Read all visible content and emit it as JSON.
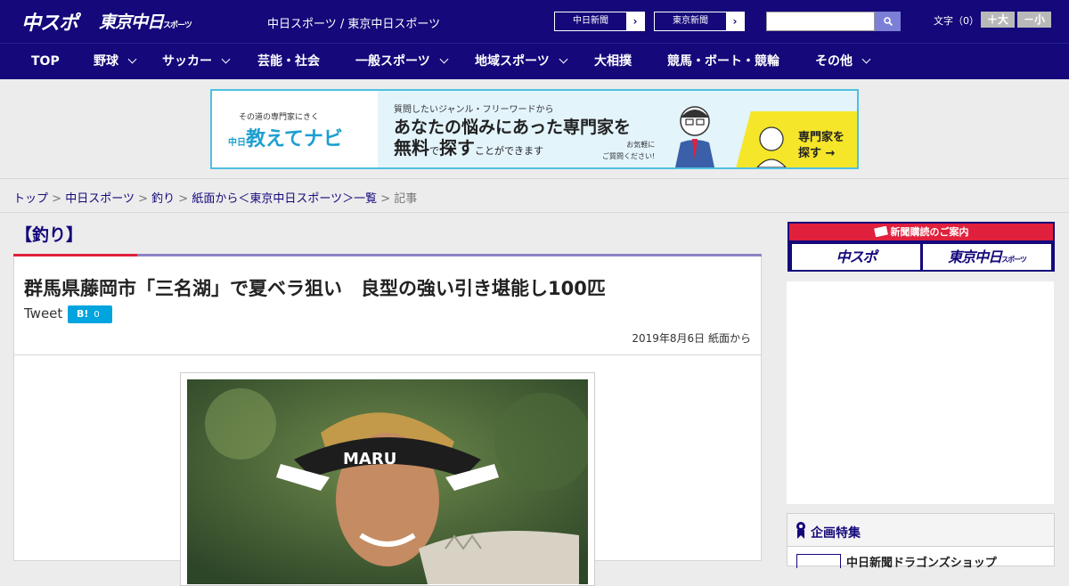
{
  "header": {
    "logo_chuspo": "中スポ",
    "logo_tokyo": "東京中日",
    "logo_tokyo_sub": "スポーツ",
    "site_name": "中日スポーツ / 東京中日スポーツ",
    "paper_links": [
      {
        "label": "中日新聞",
        "arrow": "›"
      },
      {
        "label": "東京新聞",
        "arrow": "›"
      }
    ],
    "search": {
      "placeholder": "",
      "button_icon": "search-icon"
    },
    "font_size": {
      "label": "文字（0）",
      "larger": "＋大",
      "smaller": "－小"
    }
  },
  "nav": {
    "items": [
      {
        "label": "TOP",
        "has_dropdown": false
      },
      {
        "label": "野球",
        "has_dropdown": true
      },
      {
        "label": "サッカー",
        "has_dropdown": true
      },
      {
        "label": "芸能・社会",
        "has_dropdown": false
      },
      {
        "label": "一般スポーツ",
        "has_dropdown": true
      },
      {
        "label": "地域スポーツ",
        "has_dropdown": true
      },
      {
        "label": "大相撲",
        "has_dropdown": false
      },
      {
        "label": "競馬・ボート・競輪",
        "has_dropdown": false
      },
      {
        "label": "その他",
        "has_dropdown": true
      }
    ]
  },
  "banner": {
    "sub": "その道の専門家にきく",
    "brand_prefix": "中日",
    "brand": "教えてナビ",
    "line1": "質問したいジャンル・フリーワードから",
    "line2": "あなたの悩みにあった専門家を",
    "line3_a": "無料",
    "line3_b": "で",
    "line3_c": "探す",
    "line3_d": "ことができます",
    "note": "お気軽に\nご質問ください!",
    "cta_line1": "専門家を",
    "cta_line2": "探す →"
  },
  "breadcrumb": {
    "items": [
      "トップ",
      "中日スポーツ",
      "釣り",
      "紙面から＜東京中日スポーツ＞一覧"
    ],
    "separator": ">",
    "current": "記事"
  },
  "article": {
    "category": "【釣り】",
    "headline": "群馬県藤岡市「三名湖」で夏ベラ狙い　良型の強い引き堪能し100匹",
    "tweet_label": "Tweet",
    "hatena_label": "B!",
    "hatena_count": "0",
    "date": "2019年8月6日 紙面から",
    "photo_cap_text": "MARU"
  },
  "sidebar": {
    "subscription_title": "新聞購読のご案内",
    "sub_btn_1": "中スポ",
    "sub_btn_2": "東京中日",
    "sub_btn_2_sub": "スポーツ",
    "feature_title": "企画特集",
    "feature_item": "中日新聞ドラゴンズショップ"
  },
  "colors": {
    "brand_navy": "#14087a",
    "accent_red": "#e0203c",
    "hatena_blue": "#00a4de",
    "banner_yellow": "#f6e62a"
  }
}
